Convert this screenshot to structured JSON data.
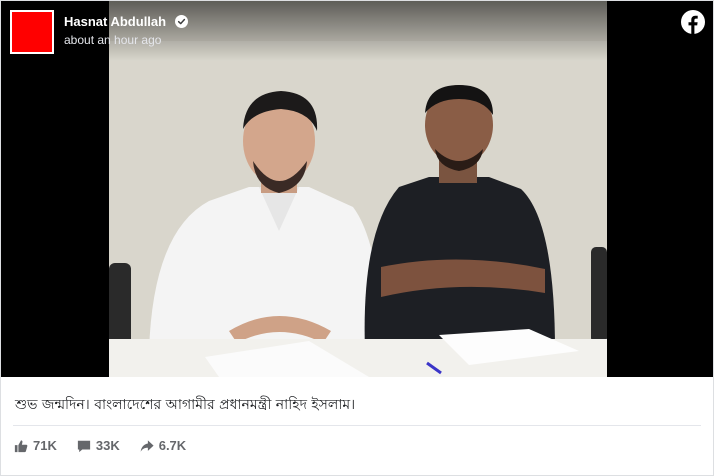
{
  "post": {
    "author": "Hasnat Abdullah",
    "timestamp": "about an hour ago",
    "avatar_color": "#ff0000",
    "caption": "শুভ জন্মদিন। বাংলাদেশের আগামীর প্রধানমন্ত্রী নাহিদ ইসলাম।"
  },
  "icons": {
    "verified": "verified-badge-icon",
    "brand": "facebook-logo-icon",
    "like": "thumbs-up-icon",
    "comment": "comment-icon",
    "share": "share-arrow-icon"
  },
  "stats": {
    "likes": "71K",
    "comments": "33K",
    "shares": "6.7K"
  },
  "colors": {
    "brand": "#ffffff",
    "stat_text": "#65676b"
  }
}
